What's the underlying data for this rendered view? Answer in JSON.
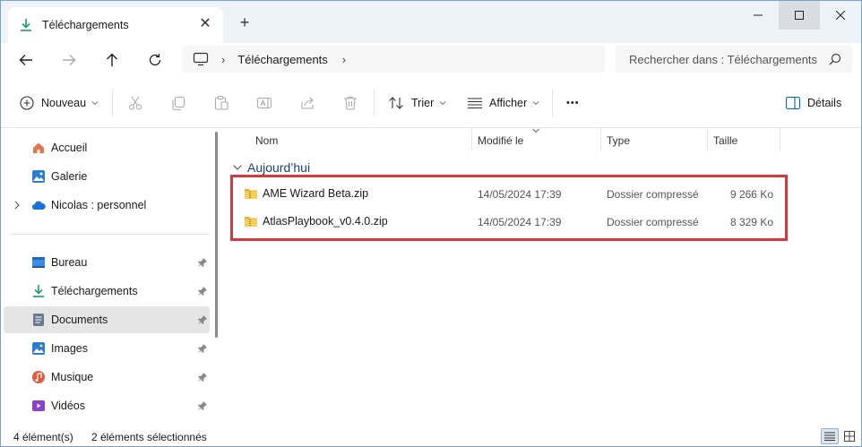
{
  "tab": {
    "title": "Téléchargements",
    "close": "✕",
    "new_tab": "+"
  },
  "address": {
    "separator": "›",
    "crumb": "Téléchargements",
    "trail": "›"
  },
  "search": {
    "placeholder": "Rechercher dans : Téléchargements"
  },
  "toolbar": {
    "new_label": "Nouveau",
    "sort_label": "Trier",
    "view_label": "Afficher",
    "more_label": "•••",
    "details_label": "Détails"
  },
  "sidebar": {
    "items": [
      {
        "label": "Accueil",
        "icon": "home-icon"
      },
      {
        "label": "Galerie",
        "icon": "gallery-icon"
      },
      {
        "label": "Nicolas : personnel",
        "icon": "onedrive-icon"
      }
    ],
    "pinned": [
      {
        "label": "Bureau",
        "icon": "desktop-icon"
      },
      {
        "label": "Téléchargements",
        "icon": "download-icon"
      },
      {
        "label": "Documents",
        "icon": "documents-icon"
      },
      {
        "label": "Images",
        "icon": "pictures-icon"
      },
      {
        "label": "Musique",
        "icon": "music-icon"
      },
      {
        "label": "Vidéos",
        "icon": "videos-icon"
      }
    ]
  },
  "columns": {
    "name": "Nom",
    "modified": "Modifié le",
    "type": "Type",
    "size": "Taille"
  },
  "group": {
    "label": "Aujourd’hui"
  },
  "files": [
    {
      "name": "AME Wizard Beta.zip",
      "date": "14/05/2024 17:39",
      "type": "Dossier compressé",
      "size": "9 266 Ko"
    },
    {
      "name": "AtlasPlaybook_v0.4.0.zip",
      "date": "14/05/2024 17:39",
      "type": "Dossier compressé",
      "size": "8 329 Ko"
    }
  ],
  "status": {
    "count": "4 élément(s)",
    "selected": "2 éléments sélectionnés"
  },
  "colors": {
    "accent": "#0067c0",
    "highlight": "#d9363e",
    "group_text": "#1c3f7a",
    "download_green": "#1a9b6e"
  }
}
